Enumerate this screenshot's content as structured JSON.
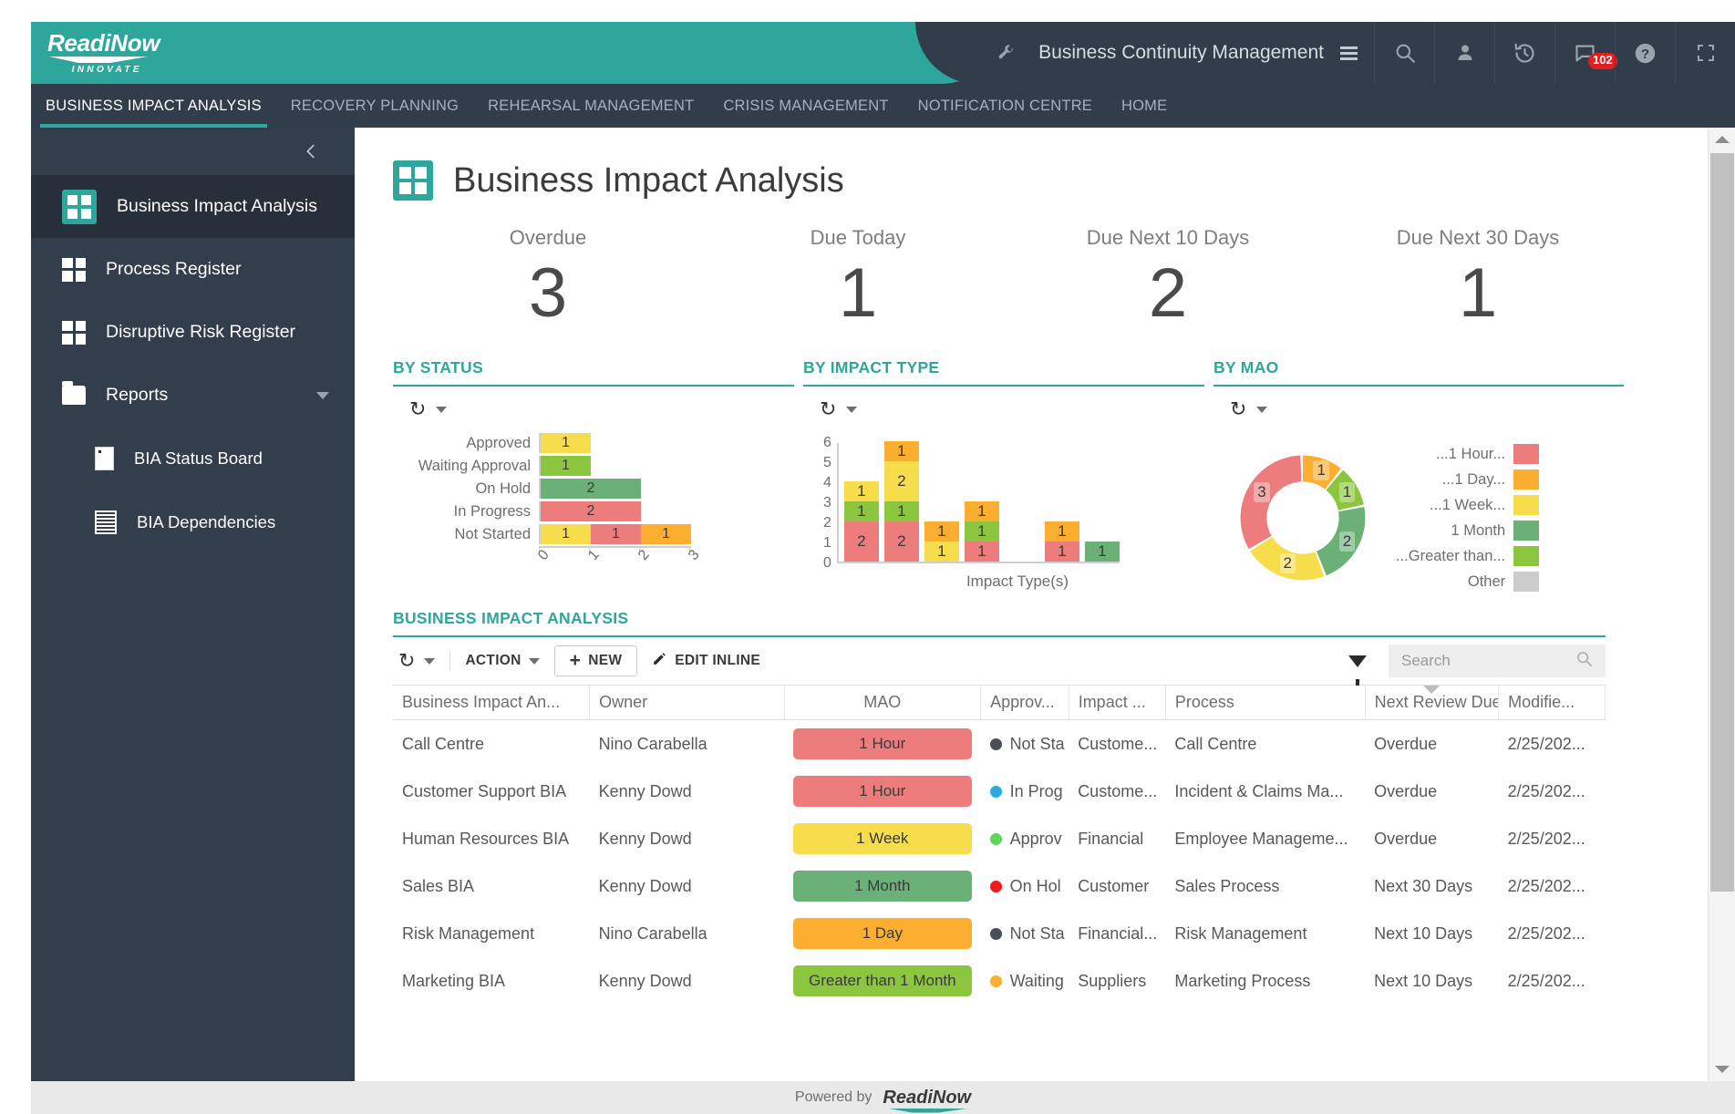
{
  "brand": {
    "name": "ReadiNow",
    "tagline": "INNOVATE"
  },
  "header": {
    "app_title": "Business Continuity Management",
    "wrench_icon": "wrench-icon",
    "menu_icon": "hamburger-icon",
    "icons": [
      {
        "name": "search-icon",
        "glyph": "search"
      },
      {
        "name": "user-icon",
        "glyph": "user"
      },
      {
        "name": "history-icon",
        "glyph": "history"
      },
      {
        "name": "messages-icon",
        "glyph": "chat",
        "badge": "102"
      },
      {
        "name": "help-icon",
        "glyph": "help"
      },
      {
        "name": "fullscreen-icon",
        "glyph": "fullscreen"
      }
    ]
  },
  "nav": {
    "tabs": [
      {
        "label": "BUSINESS IMPACT ANALYSIS",
        "active": true
      },
      {
        "label": "RECOVERY PLANNING",
        "active": false
      },
      {
        "label": "REHEARSAL MANAGEMENT",
        "active": false
      },
      {
        "label": "CRISIS MANAGEMENT",
        "active": false
      },
      {
        "label": "NOTIFICATION CENTRE",
        "active": false
      },
      {
        "label": "HOME",
        "active": false
      }
    ]
  },
  "sidebar": {
    "collapse_icon": "chevron-left-icon",
    "items": [
      {
        "label": "Business Impact Analysis",
        "icon": "grid-icon",
        "active": true
      },
      {
        "label": "Process Register",
        "icon": "grid-icon",
        "active": false
      },
      {
        "label": "Disruptive Risk Register",
        "icon": "grid-icon",
        "active": false
      },
      {
        "label": "Reports",
        "icon": "folder-icon",
        "active": false,
        "expandable": true
      },
      {
        "label": "BIA Status Board",
        "icon": "document-icon",
        "active": false,
        "sub": true
      },
      {
        "label": "BIA Dependencies",
        "icon": "list-icon",
        "active": false,
        "sub": true
      }
    ]
  },
  "page": {
    "title": "Business Impact Analysis",
    "icon": "grid-icon"
  },
  "kpis": [
    {
      "label": "Overdue",
      "value": "3"
    },
    {
      "label": "Due Today",
      "value": "1"
    },
    {
      "label": "Due Next 10 Days",
      "value": "2"
    },
    {
      "label": "Due Next 30 Days",
      "value": "1"
    }
  ],
  "colors": {
    "teal": "#2fa69b",
    "red": "#ed7d7d",
    "orange": "#fbae2f",
    "yellow": "#f7dc4b",
    "dark_green": "#6bb177",
    "light_green": "#8cc63e",
    "grey": "#cccccc",
    "status_not_started": "#4a4f55",
    "status_in_progress": "#29abe2",
    "status_approved": "#5fd45f",
    "status_on_hold": "#ef1b1b",
    "status_waiting": "#fbae2f"
  },
  "chart_data": [
    {
      "type": "bar",
      "orientation": "horizontal",
      "title": "BY STATUS",
      "refresh_icon": "refresh-icon",
      "categories": [
        "Approved",
        "Waiting Approval",
        "On Hold",
        "In Progress",
        "Not Started"
      ],
      "xlabel": "",
      "ylabel": "",
      "xlim": [
        0,
        3
      ],
      "xticks": [
        "0",
        "1",
        "2",
        "3"
      ],
      "grid": false,
      "stacks": [
        [
          {
            "value": 1,
            "color": "#f7dc4b"
          }
        ],
        [
          {
            "value": 1,
            "color": "#8cc63e"
          }
        ],
        [
          {
            "value": 2,
            "color": "#6bb177"
          }
        ],
        [
          {
            "value": 2,
            "color": "#ed7d7d"
          }
        ],
        [
          {
            "value": 1,
            "color": "#f7dc4b"
          },
          {
            "value": 1,
            "color": "#ed7d7d"
          },
          {
            "value": 1,
            "color": "#fbae2f"
          }
        ]
      ]
    },
    {
      "type": "bar",
      "orientation": "vertical",
      "stacked": true,
      "title": "BY IMPACT TYPE",
      "refresh_icon": "refresh-icon",
      "xlabel": "Impact Type(s)",
      "ylabel": "",
      "ylim": [
        0,
        6
      ],
      "yticks": [
        "0",
        "1",
        "2",
        "3",
        "4",
        "5",
        "6"
      ],
      "grid": false,
      "bars": [
        {
          "total": 4,
          "segments": [
            {
              "value": 2,
              "color": "#ed7d7d"
            },
            {
              "value": 1,
              "color": "#8cc63e"
            },
            {
              "value": 1,
              "color": "#f7dc4b"
            }
          ]
        },
        {
          "total": 6,
          "segments": [
            {
              "value": 2,
              "color": "#ed7d7d"
            },
            {
              "value": 1,
              "color": "#8cc63e"
            },
            {
              "value": 2,
              "color": "#f7dc4b"
            },
            {
              "value": 1,
              "color": "#fbae2f"
            }
          ]
        },
        {
          "total": 2,
          "segments": [
            {
              "value": 1,
              "color": "#f7dc4b"
            },
            {
              "value": 1,
              "color": "#fbae2f"
            }
          ]
        },
        {
          "total": 3,
          "segments": [
            {
              "value": 1,
              "color": "#ed7d7d"
            },
            {
              "value": 1,
              "color": "#8cc63e"
            },
            {
              "value": 1,
              "color": "#fbae2f"
            }
          ]
        },
        {
          "total": 0,
          "segments": []
        },
        {
          "total": 2,
          "segments": [
            {
              "value": 1,
              "color": "#ed7d7d"
            },
            {
              "value": 1,
              "color": "#fbae2f"
            }
          ]
        },
        {
          "total": 1,
          "segments": [
            {
              "value": 1,
              "color": "#6bb177"
            }
          ]
        }
      ]
    },
    {
      "type": "pie",
      "variant": "donut",
      "title": "BY MAO",
      "refresh_icon": "refresh-icon",
      "labels": [
        "...1 Day...",
        "...Greater than...",
        "1 Month",
        "...1 Week...",
        "...1 Hour..."
      ],
      "values": [
        1,
        1,
        2,
        2,
        3
      ],
      "slice_colors": [
        "#fbae2f",
        "#8cc63e",
        "#6bb177",
        "#f7dc4b",
        "#ed7d7d"
      ],
      "legend_position": "right",
      "legend": [
        {
          "label": "...1 Hour...",
          "color": "#ed7d7d"
        },
        {
          "label": "...1 Day...",
          "color": "#fbae2f"
        },
        {
          "label": "...1 Week...",
          "color": "#f7dc4b"
        },
        {
          "label": "1 Month",
          "color": "#6bb177"
        },
        {
          "label": "...Greater than...",
          "color": "#8cc63e"
        },
        {
          "label": "Other",
          "color": "#cccccc"
        }
      ]
    }
  ],
  "table_section": {
    "title": "BUSINESS IMPACT ANALYSIS",
    "toolbar": {
      "refresh_icon": "refresh-icon",
      "action_label": "ACTION",
      "new_label": "NEW",
      "edit_inline_label": "EDIT INLINE",
      "filter_icon": "filter-icon",
      "search_placeholder": "Search",
      "search_value": "",
      "search_icon": "search-icon"
    },
    "columns": [
      "Business Impact An...",
      "Owner",
      "MAO",
      "Approv...",
      "Impact ...",
      "Process",
      "Next Review Due",
      "Modifie..."
    ],
    "sorted_column": "Next Review Due",
    "rows": [
      {
        "name": "Call Centre",
        "owner": "Nino Carabella",
        "mao": "1 Hour",
        "mao_color": "#ed7d7d",
        "approval": "Not Sta",
        "approval_dot": "#4a4f55",
        "impact": "Custome...",
        "process": "Call Centre",
        "next_review": "Overdue",
        "next_review_class": "due-over",
        "modified": "2/25/202..."
      },
      {
        "name": "Customer Support BIA",
        "owner": "Kenny Dowd",
        "mao": "1 Hour",
        "mao_color": "#ed7d7d",
        "approval": "In Prog",
        "approval_dot": "#29abe2",
        "impact": "Custome...",
        "process": "Incident & Claims Ma...",
        "next_review": "Overdue",
        "next_review_class": "due-over",
        "modified": "2/25/202..."
      },
      {
        "name": "Human Resources BIA",
        "owner": "Kenny Dowd",
        "mao": "1 Week",
        "mao_color": "#f7dc4b",
        "approval": "Approv",
        "approval_dot": "#5fd45f",
        "impact": "Financial",
        "process": "Employee Manageme...",
        "next_review": "Overdue",
        "next_review_class": "due-over",
        "modified": "2/25/202..."
      },
      {
        "name": "Sales BIA",
        "owner": "Kenny Dowd",
        "mao": "1 Month",
        "mao_color": "#6bb177",
        "approval": "On Hol",
        "approval_dot": "#ef1b1b",
        "impact": "Customer",
        "process": "Sales Process",
        "next_review": "Next 30 Days",
        "next_review_class": "due-30",
        "modified": "2/25/202..."
      },
      {
        "name": "Risk Management",
        "owner": "Nino Carabella",
        "mao": "1 Day",
        "mao_color": "#fbae2f",
        "approval": "Not Sta",
        "approval_dot": "#4a4f55",
        "impact": "Financial...",
        "process": "Risk Management",
        "next_review": "Next 10 Days",
        "next_review_class": "due-10",
        "modified": "2/25/202..."
      },
      {
        "name": "Marketing BIA",
        "owner": "Kenny Dowd",
        "mao": "Greater than 1 Month",
        "mao_color": "#8cc63e",
        "approval": "Waiting",
        "approval_dot": "#fbae2f",
        "impact": "Suppliers",
        "process": "Marketing Process",
        "next_review": "Next 10 Days",
        "next_review_class": "due-10",
        "modified": "2/25/202..."
      }
    ]
  },
  "footer": {
    "powered_by": "Powered by",
    "brand": "ReadiNow"
  }
}
